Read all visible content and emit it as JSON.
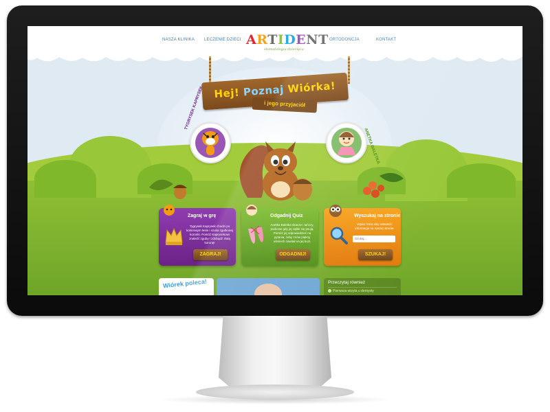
{
  "nav": {
    "items": [
      "NASZA KLINIKA",
      "LECZENIE DZIECI",
      "ORTODONCJA",
      "KONTAKT"
    ]
  },
  "logo": {
    "letters": [
      "A",
      "R",
      "T",
      "I",
      "D",
      "E",
      "NT"
    ],
    "tagline": "stomatologia dziecięca"
  },
  "hero": {
    "sign_words": [
      "Hej!",
      "Poznaj",
      "Wiórka!"
    ],
    "subsign": "i jego przyjaciół",
    "character_left": "TYGRYSEK KAPRYSEK",
    "character_right": "ANETKA BALETKA"
  },
  "panels": [
    {
      "title": "Zagraj w grę",
      "text": "Tygrysek Kaprysek chodzi po kolorowym lesie i szuka zgubionej koronki. Pomóż Kaprysekowi znaleźć zguby i zdobądź złotą koronę!",
      "button": "ZAGRAJ!"
    },
    {
      "title": "Odgadnij Quiz",
      "text": "Anetka Baletka skacze i tańczy, podczas gdy jej ząbki się psują. Pomóż jej odpowiedzieć na pytania, żeby znów piękny uśmiech zawitał na jej buzi.",
      "button": "ODGADNIJ!"
    },
    {
      "title": "Wyszukaj na stronie",
      "text": "Wpisz frazę aby odnaleźć informacje na naszej stronie.",
      "placeholder": "Szukaj...",
      "button": "SZUKAJ!"
    }
  ],
  "bottom": {
    "left_title": "Wiórek poleca!",
    "right_title": "Przeczytaj również",
    "right_item": "Pierwsza wizyta u dentysty"
  },
  "colors": {
    "purple": "#7a2c9c",
    "green": "#66a823",
    "orange": "#f08c14",
    "nav": "#3c7eb3"
  }
}
